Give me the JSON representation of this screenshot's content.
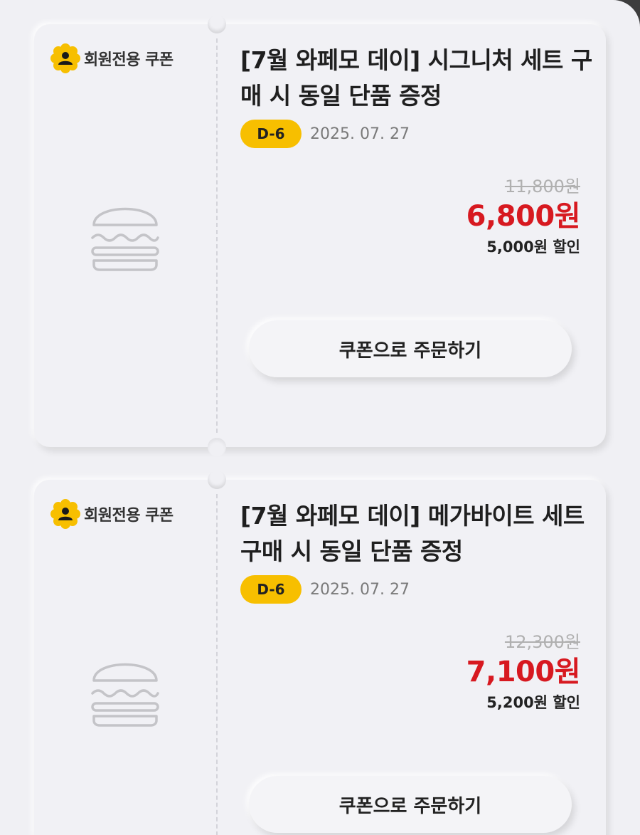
{
  "coupons": [
    {
      "member_label": "회원전용 쿠폰",
      "member_icon": "member-badge-icon",
      "product_icon": "burger-icon",
      "title": "[7월 와페모 데이] 시그니처 세트 구매 시 동일 단품 증정",
      "dday": "D-6",
      "date": "2025. 07. 27",
      "original_price": "11,800원",
      "sale_price": "6,800원",
      "discount": "5,000원 할인",
      "order_button": "쿠폰으로 주문하기"
    },
    {
      "member_label": "회원전용 쿠폰",
      "member_icon": "member-badge-icon",
      "product_icon": "burger-icon",
      "title": "[7월 와페모 데이] 메가바이트 세트 구매 시 동일 단품 증정",
      "dday": "D-6",
      "date": "2025. 07. 27",
      "original_price": "12,300원",
      "sale_price": "7,100원",
      "discount": "5,200원 할인",
      "order_button": "쿠폰으로 주문하기"
    }
  ],
  "colors": {
    "accent_yellow": "#f7bf00",
    "sale_red": "#d71920",
    "background": "#f0f0f4"
  }
}
